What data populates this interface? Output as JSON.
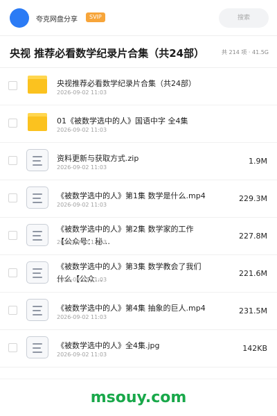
{
  "header": {
    "user_name": "夸克网盘分享",
    "badge": "SVIP",
    "search_placeholder": "搜索",
    "accent_color": "#2b7bf5"
  },
  "title": {
    "text": "央视 推荐必看数学纪录片合集（共24部）",
    "summary": "共 214 项 · 41.5G"
  },
  "files": [
    {
      "type": "folder",
      "name": "央视推荐必看数学纪录片合集（共24部）",
      "date": "2026-09-02 11:03",
      "size": ""
    },
    {
      "type": "folder",
      "name": "01《被数学选中的人》国语中字 全4集",
      "date": "2026-09-02 11:03",
      "size": ""
    },
    {
      "type": "file",
      "name": "资料更新与获取方式.zip",
      "date": "2026-09-02 11:03",
      "size": "1.9M"
    },
    {
      "type": "file",
      "name": "《被数学选中的人》第1集 数学是什么.mp4",
      "date": "2026-09-02 11:03",
      "size": "229.3M"
    },
    {
      "type": "file",
      "name": "《被数学选中的人》第2集 数学家的工作【公众号：秘…",
      "date": "2026-09-02 11:03",
      "size": "227.8M",
      "wrap": true
    },
    {
      "type": "file",
      "name": "《被数学选中的人》第3集 数学教会了我们什么【公众…",
      "date": "2026-09-02 11:03",
      "size": "221.6M",
      "wrap": true
    },
    {
      "type": "file",
      "name": "《被数学选中的人》第4集 抽象的巨人.mp4",
      "date": "2026-09-02 11:03",
      "size": "231.5M"
    },
    {
      "type": "file",
      "name": "《被数学选中的人》全4集.jpg",
      "date": "2026-09-02 11:03",
      "size": "142KB"
    }
  ],
  "footer": {
    "watermark": "msouy.com",
    "watermark_color": "#19a84a"
  }
}
